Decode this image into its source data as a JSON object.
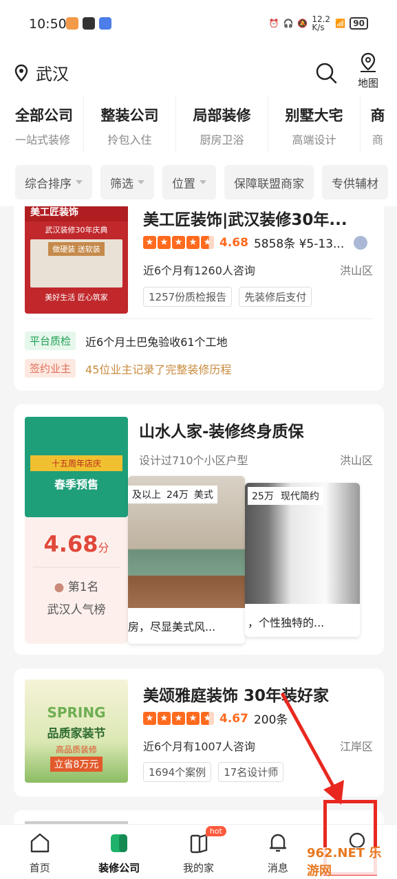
{
  "status": {
    "time": "10:50",
    "net_speed": "12.2 K/s",
    "battery": "90"
  },
  "header": {
    "city": "武汉",
    "map_label": "地图"
  },
  "categories": [
    {
      "title": "全部公司",
      "sub": "一站式装修"
    },
    {
      "title": "整装公司",
      "sub": "拎包入住"
    },
    {
      "title": "局部装修",
      "sub": "厨房卫浴"
    },
    {
      "title": "别墅大宅",
      "sub": "高端设计"
    },
    {
      "title": "商",
      "sub": "商"
    }
  ],
  "filters": [
    "综合排序",
    "筛选",
    "位置",
    "保障联盟商家",
    "专供辅材"
  ],
  "card1": {
    "name": "美工匠装饰|武汉装修30年...",
    "score": "4.68",
    "meta": "5858条 ¥5-13...",
    "consult": "近6个月有1260人咨询",
    "district": "洪山区",
    "tags": [
      "1257份质检报告",
      "先装修后支付"
    ],
    "badge1": "平台质检",
    "badge1_text": "近6个月土巴兔验收61个工地",
    "badge2": "签约业主",
    "badge2_text": "45位业主记录了完整装修历程",
    "thumb_title": "美工匠装饰",
    "thumb_sub": "武汉装修30年庆典",
    "thumb_mid": "做硬装 送软装",
    "thumb_foot": "美好生活 匠心筑家"
  },
  "card2": {
    "name": "山水人家-装修终身质保",
    "desc": "设计过710个小区户型",
    "district": "洪山区",
    "score": "4.68",
    "score_unit": "分",
    "rank": "第1名",
    "rank_sub": "武汉人气榜",
    "thumb_line1": "十五周年店庆",
    "thumb_line2": "春季预售",
    "case1_tags": [
      "及以上",
      "24万",
      "美式"
    ],
    "case1_caption": "房，尽显美式风...",
    "case2_tags": [
      "25万",
      "现代简约"
    ],
    "case2_caption": "，个性独特的..."
  },
  "card3": {
    "name": "美颂雅庭装饰 30年装好家",
    "score": "4.67",
    "meta": "200条",
    "consult": "近6个月有1007人咨询",
    "district": "江岸区",
    "tags": [
      "1694个案例",
      "17名设计师"
    ],
    "thumb_line1": "SPRING",
    "thumb_line2": "品质家装节",
    "thumb_line3": "高品质装修",
    "thumb_line4": "立省8万元"
  },
  "tabs": [
    {
      "label": "首页"
    },
    {
      "label": "装修公司"
    },
    {
      "label": "我的家",
      "badge": "hot"
    },
    {
      "label": "消息"
    },
    {
      "label": ""
    }
  ],
  "watermark": "962.NET 乐游网"
}
